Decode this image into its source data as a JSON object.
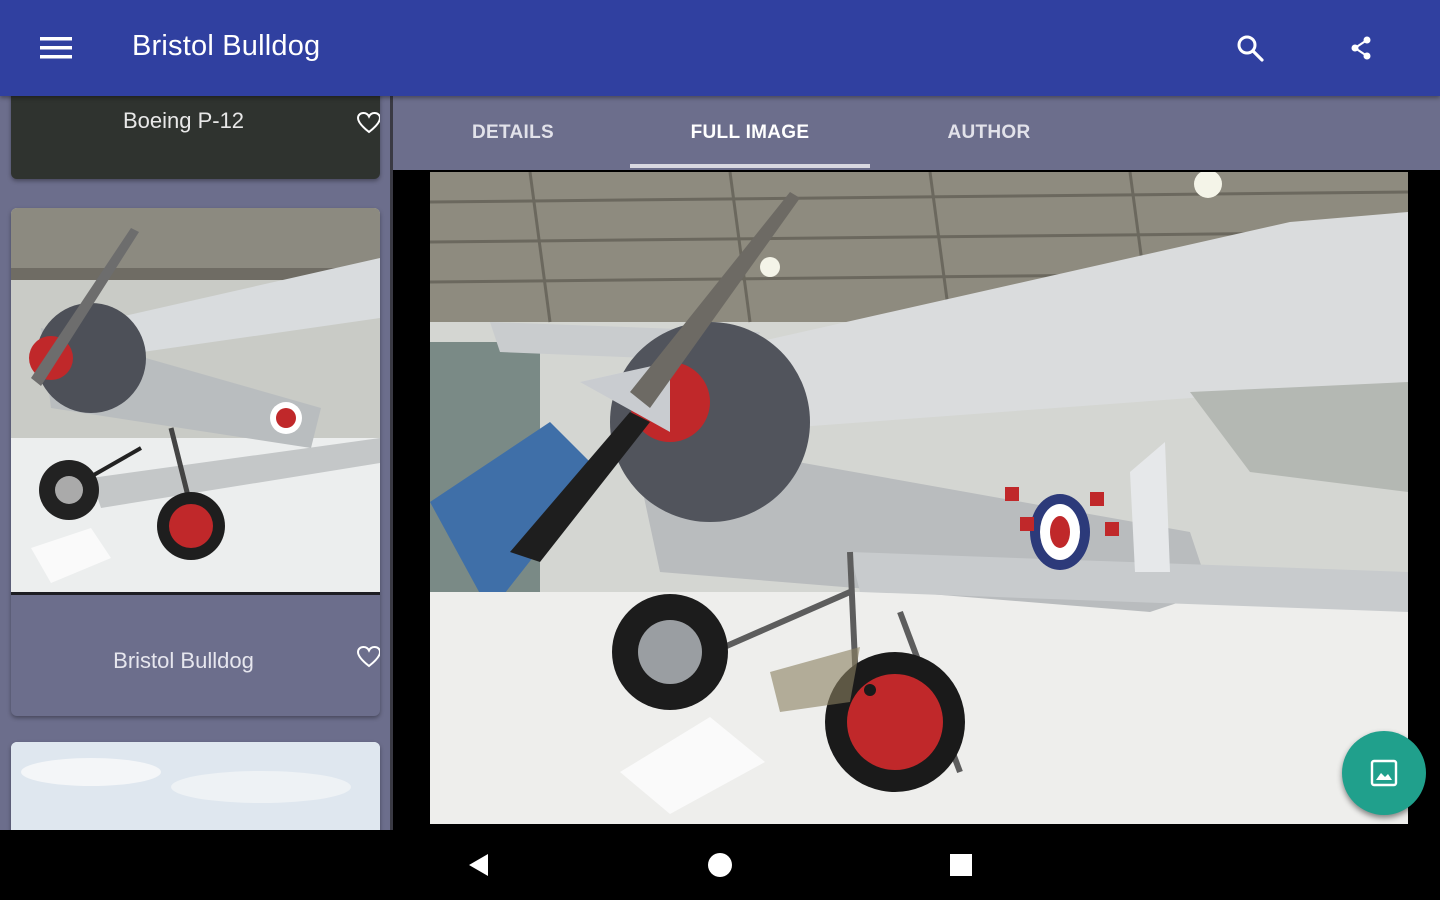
{
  "app_bar": {
    "title": "Bristol Bulldog",
    "menu_icon": "hamburger-menu-icon",
    "search_icon": "search-icon",
    "share_icon": "share-icon",
    "color": "#3040a0"
  },
  "list": {
    "items": [
      {
        "label": "Boeing P-12",
        "favorite_icon": "heart-outline-icon"
      },
      {
        "label": "Bristol Bulldog",
        "favorite_icon": "heart-outline-icon"
      }
    ]
  },
  "tabs": [
    {
      "label": "DETAILS",
      "active": false
    },
    {
      "label": "FULL IMAGE",
      "active": true
    },
    {
      "label": "AUTHOR",
      "active": false
    }
  ],
  "fab": {
    "icon": "image-icon",
    "color": "#20a08c"
  },
  "nav_bar": {
    "back_icon": "back-triangle-icon",
    "home_icon": "home-circle-icon",
    "recents_icon": "recents-square-icon"
  }
}
